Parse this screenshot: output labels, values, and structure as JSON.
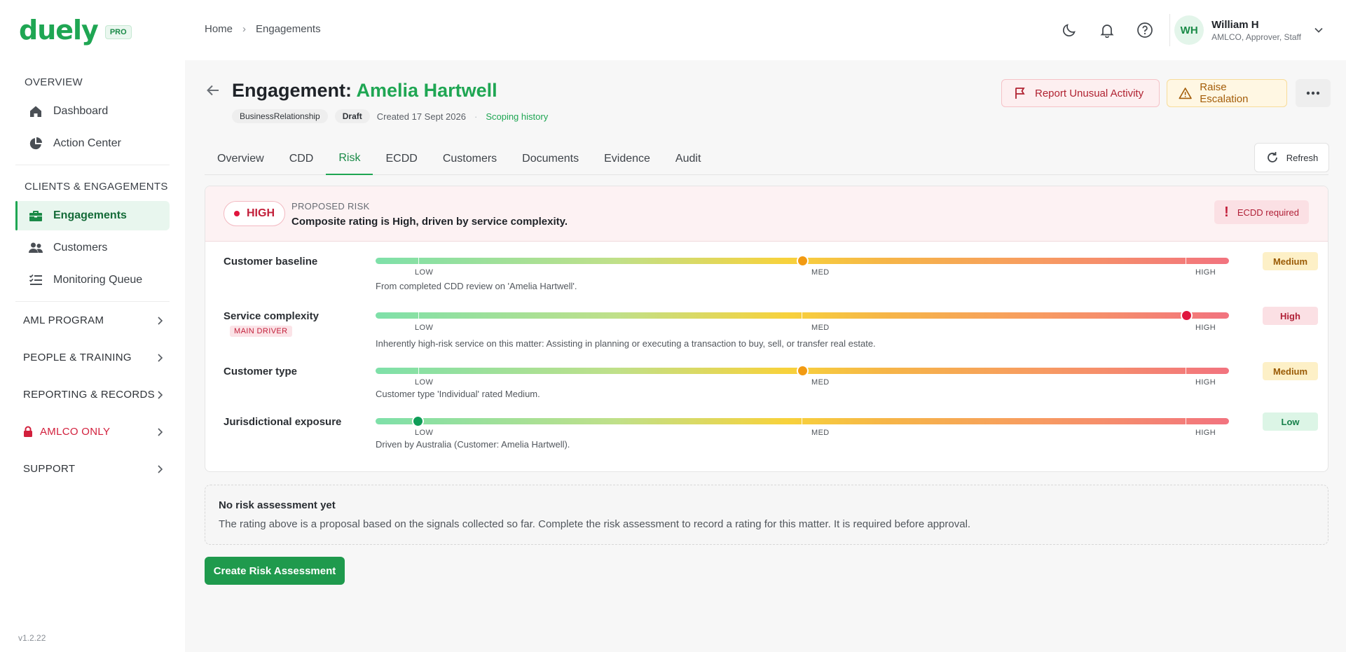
{
  "brand": {
    "name": "duely",
    "badge": "PRO"
  },
  "sidebar": {
    "sections": [
      {
        "title": "OVERVIEW",
        "items": [
          {
            "label": "Dashboard"
          },
          {
            "label": "Action Center"
          }
        ]
      },
      {
        "title": "CLIENTS & ENGAGEMENTS",
        "items": [
          {
            "label": "Engagements"
          },
          {
            "label": "Customers"
          },
          {
            "label": "Monitoring Queue"
          }
        ]
      }
    ],
    "groups": [
      {
        "label": "AML PROGRAM"
      },
      {
        "label": "PEOPLE & TRAINING"
      },
      {
        "label": "REPORTING & RECORDS"
      },
      {
        "label": "AMLCO ONLY"
      },
      {
        "label": "SUPPORT"
      }
    ],
    "version": "v1.2.22"
  },
  "breadcrumb": {
    "home": "Home",
    "current": "Engagements"
  },
  "user": {
    "initials": "WH",
    "name": "William H",
    "roles": "AMLCO, Approver, Staff"
  },
  "engagement": {
    "title_prefix": "Engagement:",
    "client": "Amelia Hartwell",
    "type": "BusinessRelationship",
    "status": "Draft",
    "created": "Created 17 Sept 2026",
    "history_link": "Scoping history"
  },
  "actions": {
    "report": "Report Unusual Activity",
    "escalate": "Raise Escalation"
  },
  "tabs": [
    {
      "label": "Overview"
    },
    {
      "label": "CDD"
    },
    {
      "label": "Risk"
    },
    {
      "label": "ECDD"
    },
    {
      "label": "Customers"
    },
    {
      "label": "Documents"
    },
    {
      "label": "Evidence"
    },
    {
      "label": "Audit"
    }
  ],
  "active_tab": "Risk",
  "refresh_label": "Refresh",
  "risk": {
    "rating": "HIGH",
    "kicker": "PROPOSED RISK",
    "summary": "Composite rating is High, driven by service complexity.",
    "ecdd": "ECDD required",
    "scale": {
      "low": "LOW",
      "med": "MED",
      "high": "HIGH"
    },
    "factors": [
      {
        "label": "Customer baseline",
        "value": 0.5,
        "level": "Medium",
        "note": "From completed CDD review on 'Amelia Hartwell'.",
        "driver": ""
      },
      {
        "label": "Service complexity",
        "value": 0.95,
        "level": "High",
        "note": "Inherently high-risk service on this matter: Assisting in planning or executing a transaction to buy, sell, or transfer real estate.",
        "driver": "MAIN DRIVER"
      },
      {
        "label": "Customer type",
        "value": 0.5,
        "level": "Medium",
        "note": "Customer type 'Individual' rated Medium.",
        "driver": ""
      },
      {
        "label": "Jurisdictional exposure",
        "value": 0.05,
        "level": "Low",
        "note": "Driven by Australia (Customer: Amelia Hartwell).",
        "driver": ""
      }
    ],
    "level_colors": {
      "Low": "#0f9d58",
      "Medium": "#f29a12",
      "High": "#e0163e"
    }
  },
  "assessment": {
    "title": "No risk assessment yet",
    "body": "The rating above is a proposal based on the signals collected so far. Complete the risk assessment to record a rating for this matter. It is required before approval.",
    "button": "Create Risk Assessment"
  }
}
